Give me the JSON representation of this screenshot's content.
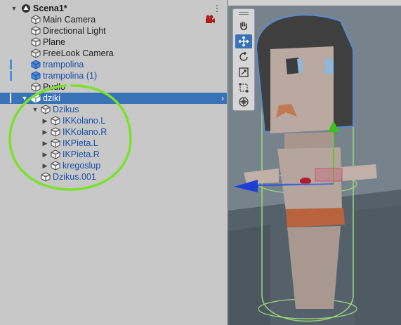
{
  "hierarchy": {
    "scene_name": "Scena1*",
    "items": [
      {
        "label": "Main Camera"
      },
      {
        "label": "Directional Light"
      },
      {
        "label": "Plane"
      },
      {
        "label": "FreeLook Camera"
      },
      {
        "label": "trampolina"
      },
      {
        "label": "trampolina (1)"
      },
      {
        "label": "Pudlo"
      },
      {
        "label": "dziki"
      },
      {
        "label": "Dzikus"
      },
      {
        "label": "IKKolano.L"
      },
      {
        "label": "IKKolano.R"
      },
      {
        "label": "IKPieta.L"
      },
      {
        "label": "IKPieta.R"
      },
      {
        "label": "kregoslup"
      },
      {
        "label": "Dzikus.001"
      }
    ]
  },
  "colors": {
    "selection": "#3a72b8",
    "prefab_text": "#1b4fa8",
    "annotation_circle": "#7be22b",
    "scene_bg": "#7e8a93"
  },
  "scene_tools": [
    "hand-tool",
    "move-tool",
    "rotate-tool",
    "scale-tool",
    "rect-tool",
    "transform-tool"
  ]
}
